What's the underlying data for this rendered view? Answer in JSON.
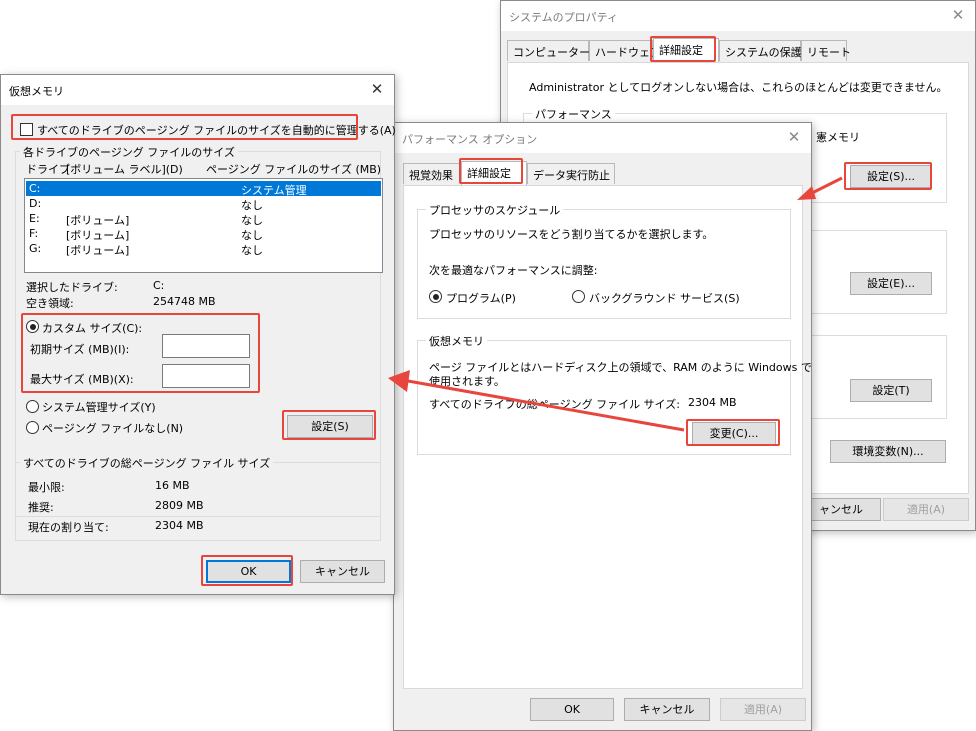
{
  "system_properties": {
    "title": "システムのプロパティ",
    "tabs": [
      {
        "label": "コンピューター名"
      },
      {
        "label": "ハードウェア"
      },
      {
        "label": "詳細設定"
      },
      {
        "label": "システムの保護"
      },
      {
        "label": "リモート"
      }
    ],
    "admin_note": "Administrator としてログオンしない場合は、これらのほとんどは変更できません。",
    "performance_group": "パフォーマンス",
    "performance_partial": "憲メモリ",
    "settings_s": "設定(S)...",
    "settings_e": "設定(E)...",
    "settings_t": "設定(T)",
    "env_vars": "環境変数(N)...",
    "cancel_partial": "ャンセル",
    "apply": "適用(A)"
  },
  "performance_options": {
    "title": "パフォーマンス オプション",
    "tabs": [
      {
        "label": "視覚効果"
      },
      {
        "label": "詳細設定"
      },
      {
        "label": "データ実行防止"
      }
    ],
    "scheduling_group": "プロセッサのスケジュール",
    "scheduling_desc": "プロセッサのリソースをどう割り当てるかを選択します。",
    "adjust_label": "次を最適なパフォーマンスに調整:",
    "radio_programs": "プログラム(P)",
    "radio_background": "バックグラウンド サービス(S)",
    "vm_group": "仮想メモリ",
    "vm_desc_line1": "ページ ファイルとはハードディスク上の領域で、RAM のように Windows で",
    "vm_desc_line2": "使用されます。",
    "vm_total_label": "すべてのドライブの総ページング ファイル サイズ:",
    "vm_total_value": "2304 MB",
    "change_button": "変更(C)...",
    "ok": "OK",
    "cancel": "キャンセル",
    "apply": "適用(A)"
  },
  "virtual_memory": {
    "title": "仮想メモリ",
    "auto_manage": "すべてのドライブのページング ファイルのサイズを自動的に管理する(A)",
    "per_drive_group": "各ドライブのページング ファイルのサイズ",
    "col_drive": "ドライブ",
    "col_volume": "[ボリューム ラベル](D)",
    "col_size": "ページング ファイルのサイズ (MB)",
    "drives": [
      {
        "drive": "C:",
        "label": "",
        "size": "システム管理"
      },
      {
        "drive": "D:",
        "label": "",
        "size": "なし"
      },
      {
        "drive": "E:",
        "label": "[ボリューム]",
        "size": "なし"
      },
      {
        "drive": "F:",
        "label": "[ボリューム]",
        "size": "なし"
      },
      {
        "drive": "G:",
        "label": "[ボリューム]",
        "size": "なし"
      }
    ],
    "selected_drive_label": "選択したドライブ:",
    "selected_drive_value": "C:",
    "free_space_label": "空き領域:",
    "free_space_value": "254748 MB",
    "custom_size": "カスタム サイズ(C):",
    "initial_size": "初期サイズ (MB)(I):",
    "max_size": "最大サイズ (MB)(X):",
    "initial_value": "",
    "max_value": "",
    "system_managed": "システム管理サイズ(Y)",
    "no_paging": "ページング ファイルなし(N)",
    "set_button": "設定(S)",
    "total_group": "すべてのドライブの総ページング ファイル サイズ",
    "min_label": "最小限:",
    "min_value": "16 MB",
    "recommended_label": "推奨:",
    "recommended_value": "2809 MB",
    "current_label": "現在の割り当て:",
    "current_value": "2304 MB",
    "ok": "OK",
    "cancel": "キャンセル"
  },
  "colors": {
    "highlight": "#e8453c",
    "selection": "#0078d7"
  }
}
